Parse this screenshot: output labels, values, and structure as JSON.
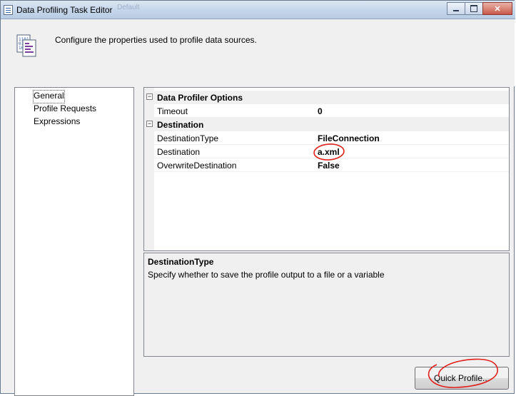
{
  "window": {
    "title": "Data Profiling Task Editor",
    "ghost_text": "Default",
    "buttons": {
      "minimize": "",
      "maximize": "",
      "close": "✕"
    }
  },
  "header": {
    "description": "Configure the properties used to profile data sources.",
    "icon": "profiling-task-icon"
  },
  "nav": {
    "items": [
      {
        "label": "General",
        "selected": true
      },
      {
        "label": "Profile Requests",
        "selected": false
      },
      {
        "label": "Expressions",
        "selected": false
      }
    ]
  },
  "grid": {
    "categories": [
      {
        "name": "Data Profiler Options",
        "toggle": "−",
        "properties": [
          {
            "name": "Timeout",
            "value": "0"
          }
        ]
      },
      {
        "name": "Destination",
        "toggle": "−",
        "properties": [
          {
            "name": "DestinationType",
            "value": "FileConnection"
          },
          {
            "name": "Destination",
            "value": "a.xml"
          },
          {
            "name": "OverwriteDestination",
            "value": "False"
          }
        ]
      }
    ]
  },
  "description_pane": {
    "title": "DestinationType",
    "text": "Specify whether to save the profile output to a file or a variable"
  },
  "buttons": {
    "quick_profile": "Quick Profile..."
  },
  "colors": {
    "annotation": "#e0201a",
    "window_bg": "#f0f0f0",
    "grid_border": "#828790"
  }
}
